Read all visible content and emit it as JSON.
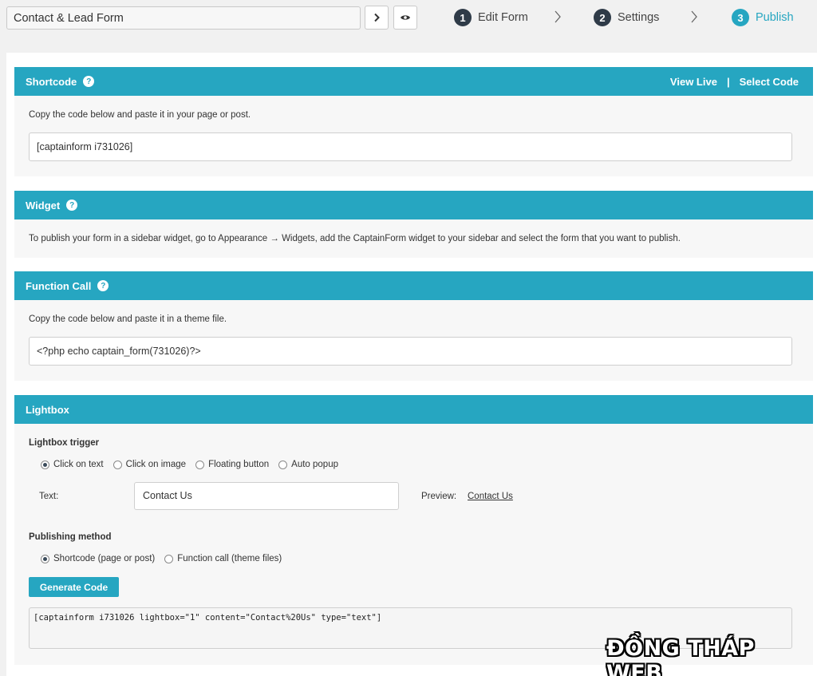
{
  "header": {
    "form_title": "Contact & Lead Form",
    "steps": [
      {
        "num": "1",
        "label": "Edit Form"
      },
      {
        "num": "2",
        "label": "Settings"
      },
      {
        "num": "3",
        "label": "Publish"
      }
    ],
    "active_step": 3
  },
  "shortcode": {
    "title": "Shortcode",
    "view_live": "View Live",
    "separator": "|",
    "select_code": "Select Code",
    "description": "Copy the code below and paste it in your page or post.",
    "code": "[captainform i731026]"
  },
  "widget": {
    "title": "Widget",
    "description": "To publish your form in a sidebar widget, go to Appearance → Widgets, add the CaptainForm widget to your sidebar and select the form that you want to publish."
  },
  "function_call": {
    "title": "Function Call",
    "description": "Copy the code below and paste it in a theme file.",
    "code": "<?php echo captain_form(731026)?>"
  },
  "lightbox": {
    "title": "Lightbox",
    "trigger_label": "Lightbox trigger",
    "trigger_options": [
      "Click on text",
      "Click on image",
      "Floating button",
      "Auto popup"
    ],
    "trigger_selected": "Click on text",
    "text_label": "Text:",
    "text_value": "Contact Us",
    "preview_label": "Preview:",
    "preview_link": "Contact Us",
    "method_label": "Publishing method",
    "method_options": [
      "Shortcode (page or post)",
      "Function call (theme files)"
    ],
    "method_selected": "Shortcode (page or post)",
    "generate_button": "Generate Code",
    "generated_code": "[captainform i731026 lightbox=\"1\" content=\"Contact%20Us\" type=\"text\"]"
  },
  "help_glyph": "?",
  "watermark": "ĐỒNG THÁP WEB",
  "colors": {
    "accent": "#26a6c1",
    "step_inactive": "#2f3b48"
  },
  "icons": [
    "chevron-right-icon",
    "eye-icon",
    "help-icon"
  ]
}
